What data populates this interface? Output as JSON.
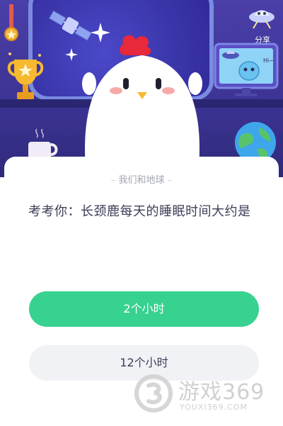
{
  "header": {
    "share_label": "分享",
    "monitor_speech": "Hi~"
  },
  "card": {
    "category": "我们和地球",
    "category_left_dash": "–",
    "category_right_dash": "–",
    "question": "考考你：长颈鹿每天的睡眠时间大约是",
    "options": [
      {
        "label": "2个小时"
      },
      {
        "label": "12个小时"
      }
    ]
  },
  "watermark": {
    "brand": "游戏369",
    "url": "YOUXI369.COM"
  },
  "colors": {
    "scene_bg": "#3d3494",
    "primary_option": "#37d28f",
    "secondary_option": "#f1f2f6",
    "text_dark": "#3b3e57"
  }
}
